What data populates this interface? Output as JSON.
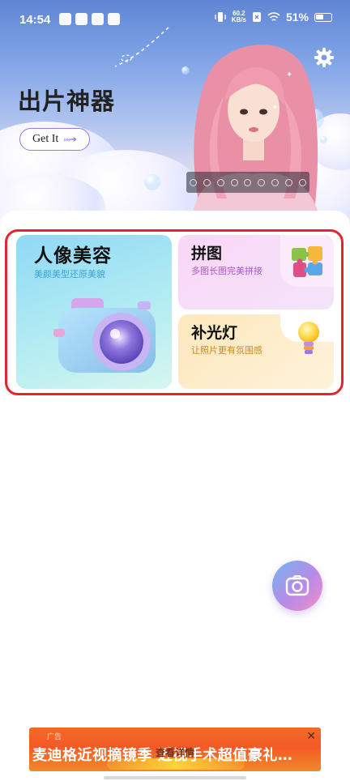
{
  "status_bar": {
    "time": "14:54",
    "net_speed_value": "60.2",
    "net_speed_unit": "KB/s",
    "battery_percent": "51%"
  },
  "hero": {
    "title": "出片神器",
    "cta_label": "Get It"
  },
  "features": {
    "portrait": {
      "title": "人像美容",
      "subtitle": "美颜美型还原美貌",
      "icon": "camera-icon"
    },
    "puzzle": {
      "title": "拼图",
      "subtitle": "多图长图完美拼接",
      "icon": "puzzle-icon"
    },
    "fill_light": {
      "title": "补光灯",
      "subtitle": "让照片更有氛围感",
      "icon": "lightbulb-icon"
    }
  },
  "fab": {
    "icon": "camera-icon"
  },
  "ad": {
    "tag": "广告",
    "text": "麦迪格近视摘镜季 近视手术超值豪礼…",
    "overlay_text": "查看详情",
    "close_icon": "close-icon"
  },
  "colors": {
    "highlight_border": "#e1262f",
    "accent_purple": "#7b6ff0",
    "ad_orange": "#f45a25"
  }
}
